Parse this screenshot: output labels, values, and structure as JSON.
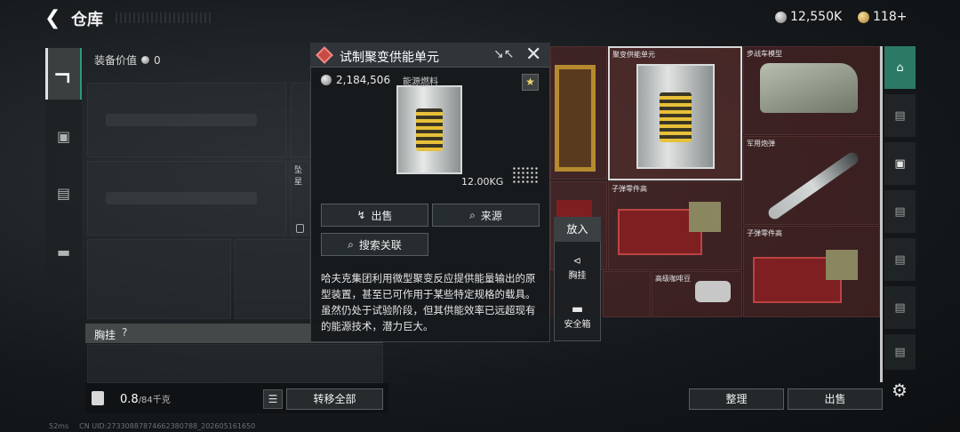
{
  "header": {
    "title": "仓库",
    "silver_amount": "12,550K",
    "gold_amount": "118+"
  },
  "equipment": {
    "label": "装备价值",
    "value": "0",
    "slot_label_a": "坠星",
    "chest_label": "胸挂",
    "chest_help": "?"
  },
  "bottom_left": {
    "weight_value": "0.8",
    "weight_max": "/84千克",
    "transfer_all": "转移全部"
  },
  "storage": {
    "items": [
      {
        "label": "聚变供能单元"
      },
      {
        "label": "步战车模型"
      },
      {
        "label": "军用炮弹"
      },
      {
        "label": "子弹零件高"
      },
      {
        "label": "子弹零件高"
      },
      {
        "label": "高级咖啡豆"
      }
    ],
    "sort_button": "整理",
    "sell_button": "出售"
  },
  "popup": {
    "title": "试制聚变供能单元",
    "price": "2,184,506",
    "type": "能源燃料",
    "weight": "12.00KG",
    "sell_button": "出售",
    "source_button": "来源",
    "search_button": "搜索关联",
    "description": "哈夫克集团利用微型聚变反应提供能量输出的原型装置，甚至已可作用于某些特定规格的载具。虽然仍处于试验阶段，但其供能效率已远超现有的能源技术，潜力巨大。"
  },
  "flyout": {
    "header": "放入",
    "item_1": "胸挂",
    "item_2": "安全箱"
  },
  "status": {
    "ping": "52ms",
    "uid": "CN UID:2733088787466238078​8_202605161650"
  },
  "colors": {
    "accent_green": "#2c7a66",
    "popup_red": "#c94a44",
    "star_gold": "#f3d36a"
  }
}
